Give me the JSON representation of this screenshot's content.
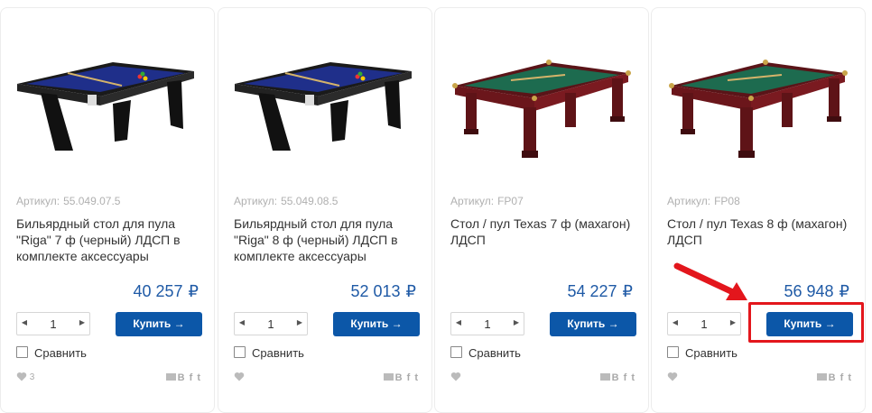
{
  "sku_label": "Артикул:",
  "currency": "₽",
  "buy_label": "Купить →",
  "compare_label": "Сравнить",
  "share_letters": "B f t",
  "colors": {
    "accent": "#0c57a8",
    "price": "#1f5aa6",
    "highlight": "#e3161c"
  },
  "products": [
    {
      "sku": "55.049.07.5",
      "title": "Бильярдный стол для пула \"Riga\" 7 ф (черный) ЛДСП в комплекте аксессуары",
      "price": "40 257",
      "qty": "1",
      "likes": "3",
      "image": "black-pool-table"
    },
    {
      "sku": "55.049.08.5",
      "title": "Бильярдный стол для пула \"Riga\" 8 ф (черный) ЛДСП в комплекте аксессуары",
      "price": "52 013",
      "qty": "1",
      "likes": "",
      "image": "black-pool-table"
    },
    {
      "sku": "FP07",
      "title": "Стол / пул Texas 7 ф (махагон) ЛДСП",
      "price": "54 227",
      "qty": "1",
      "likes": "",
      "image": "mahogany-pool-table"
    },
    {
      "sku": "FP08",
      "title": "Стол / пул Texas 8 ф (махагон) ЛДСП",
      "price": "56 948",
      "qty": "1",
      "likes": "",
      "image": "mahogany-pool-table"
    }
  ]
}
